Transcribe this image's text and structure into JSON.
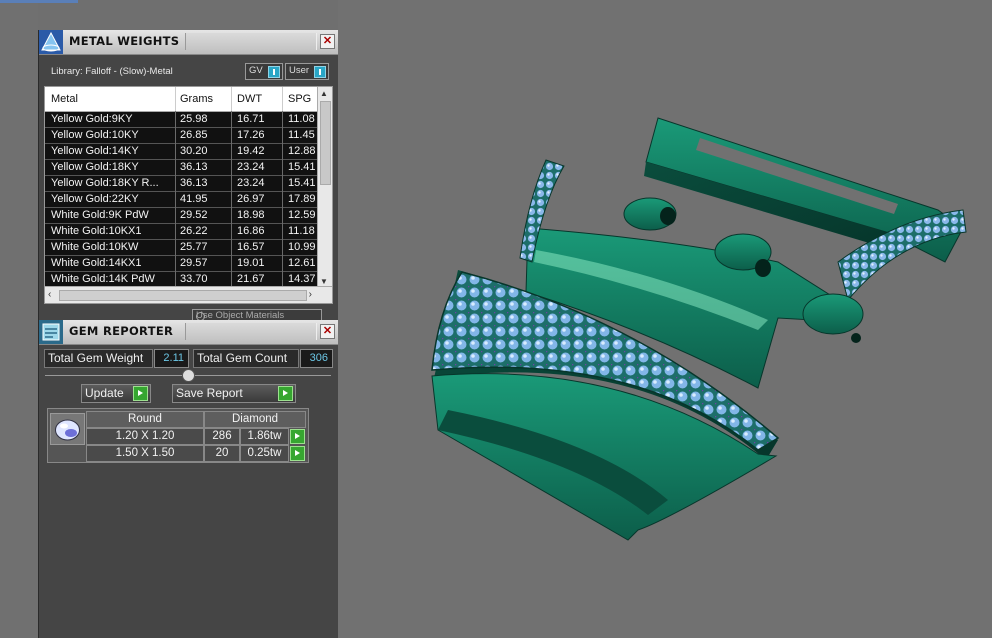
{
  "metal_weights": {
    "title": "METAL WEIGHTS",
    "library_label": "Library: Falloff - (Slow)-Metal",
    "toggles": [
      "GV",
      "User"
    ],
    "columns": [
      "Metal",
      "Grams",
      "DWT",
      "SPG"
    ],
    "rows": [
      [
        "Yellow Gold:9KY",
        "25.98",
        "16.71",
        "11.08"
      ],
      [
        "Yellow Gold:10KY",
        "26.85",
        "17.26",
        "11.45"
      ],
      [
        "Yellow Gold:14KY",
        "30.20",
        "19.42",
        "12.88"
      ],
      [
        "Yellow Gold:18KY",
        "36.13",
        "23.24",
        "15.41"
      ],
      [
        "Yellow Gold:18KY R...",
        "36.13",
        "23.24",
        "15.41"
      ],
      [
        "Yellow Gold:22KY",
        "41.95",
        "26.97",
        "17.89"
      ],
      [
        "White Gold:9K PdW",
        "29.52",
        "18.98",
        "12.59"
      ],
      [
        "White Gold:10KX1",
        "26.22",
        "16.86",
        "11.18"
      ],
      [
        "White Gold:10KW",
        "25.77",
        "16.57",
        "10.99"
      ],
      [
        "White Gold:14KX1",
        "29.57",
        "19.01",
        "12.61"
      ],
      [
        "White Gold:14K PdW",
        "33.70",
        "21.67",
        "14.37"
      ]
    ],
    "use_object_materials": "Use Object Materials"
  },
  "gem_reporter": {
    "title": "GEM REPORTER",
    "total_weight_label": "Total Gem Weight",
    "total_weight_value": "2.11",
    "total_count_label": "Total Gem Count",
    "total_count_value": "306",
    "update_label": "Update",
    "save_report_label": "Save Report",
    "table_header": [
      "Round",
      "Diamond"
    ],
    "gems": [
      [
        "1.20 X 1.20",
        "286",
        "1.86tw"
      ],
      [
        "1.50 X 1.50",
        "20",
        "0.25tw"
      ]
    ]
  },
  "icons": [
    "metal-weights-icon",
    "gem-reporter-icon",
    "close-icon",
    "round-gem-icon",
    "go-arrow-icon"
  ],
  "colors": {
    "model_green": "#11705a",
    "gem_blue": "#7fb0e0",
    "go_green": "#36a630"
  }
}
